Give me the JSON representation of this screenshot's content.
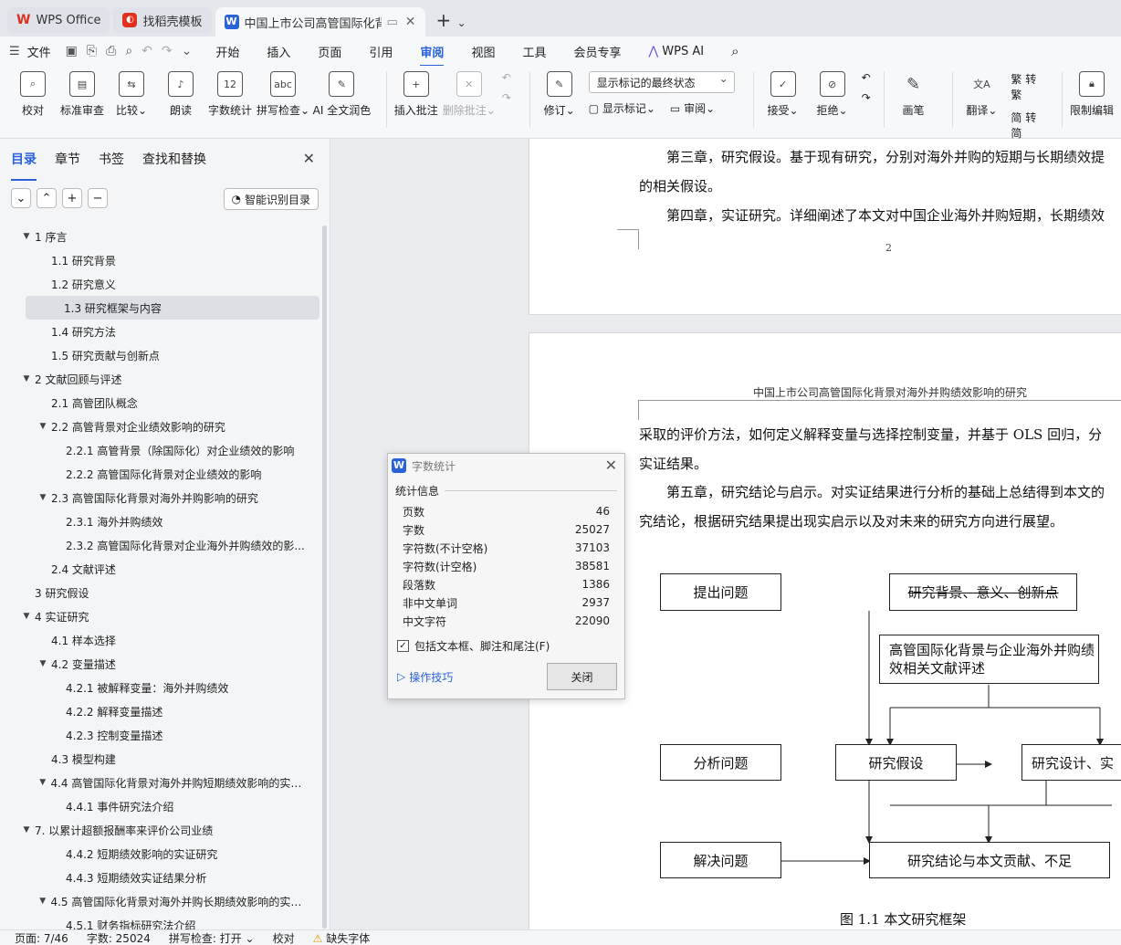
{
  "tabs": [
    {
      "label": "WPS Office"
    },
    {
      "label": "找稻壳模板"
    },
    {
      "label": "中国上市公司高管国际化背景..."
    }
  ],
  "menu": {
    "file": "文件",
    "items": [
      "开始",
      "插入",
      "页面",
      "引用",
      "审阅",
      "视图",
      "工具",
      "会员专享"
    ],
    "active": "审阅",
    "ai": "WPS AI"
  },
  "ribbon": {
    "group1": [
      "校对",
      "标准审查",
      "比较",
      "朗读",
      "字数统计",
      "拼写检查",
      "AI 全文润色"
    ],
    "comments": [
      "插入批注",
      "删除批注"
    ],
    "track": {
      "revise": "修订",
      "select": "显示标记的最终状态",
      "show": "显示标记",
      "review": "审阅"
    },
    "accept": "接受",
    "reject": "拒绝",
    "pen": "画笔",
    "translate": "翻译",
    "to_trad": "转繁",
    "to_simp": "转简",
    "restrict": "限制编辑"
  },
  "sidebar": {
    "tabs": [
      "目录",
      "章节",
      "书签",
      "查找和替换"
    ],
    "smart": "智能识别目录",
    "toc": [
      {
        "level": 0,
        "text": "1  序言",
        "arrow": "▼"
      },
      {
        "level": 1,
        "text": "1.1  研究背景"
      },
      {
        "level": 1,
        "text": "1.2  研究意义"
      },
      {
        "level": 1,
        "text": "1.3  研究框架与内容",
        "selected": true
      },
      {
        "level": 1,
        "text": "1.4  研究方法"
      },
      {
        "level": 1,
        "text": "1.5  研究贡献与创新点"
      },
      {
        "level": 0,
        "text": "2  文献回顾与评述",
        "arrow": "▼"
      },
      {
        "level": 1,
        "text": "2.1 高管团队概念"
      },
      {
        "level": 1,
        "text": "2.2  高管背景对企业绩效影响的研究",
        "arrow": "▼"
      },
      {
        "level": 2,
        "text": "2.2.1  高管背景（除国际化）对企业绩效的影响"
      },
      {
        "level": 2,
        "text": "2.2.2  高管国际化背景对企业绩效的影响"
      },
      {
        "level": 1,
        "text": "2.3  高管国际化背景对海外并购影响的研究",
        "arrow": "▼"
      },
      {
        "level": 2,
        "text": "2.3.1  海外并购绩效"
      },
      {
        "level": 2,
        "text": "2.3.2  高管国际化背景对企业海外并购绩效的影..."
      },
      {
        "level": 1,
        "text": "2.4  文献评述"
      },
      {
        "level": 0,
        "text": "3  研究假设"
      },
      {
        "level": 0,
        "text": "4  实证研究",
        "arrow": "▼"
      },
      {
        "level": 1,
        "text": "4.1 样本选择"
      },
      {
        "level": 1,
        "text": "4.2  变量描述",
        "arrow": "▼"
      },
      {
        "level": 2,
        "text": "4.2.1  被解释变量：海外并购绩效"
      },
      {
        "level": 2,
        "text": "4.2.2  解释变量描述"
      },
      {
        "level": 2,
        "text": "4.2.3  控制变量描述"
      },
      {
        "level": 1,
        "text": "4.3  模型构建"
      },
      {
        "level": 1,
        "text": "4.4  高管国际化背景对海外并购短期绩效影响的实证 ...",
        "arrow": "▼"
      },
      {
        "level": 2,
        "text": "4.4.1  事件研究法介绍"
      },
      {
        "level": 0,
        "text": "7.  以累计超额报酬率来评价公司业绩",
        "arrow": "▼"
      },
      {
        "level": 2,
        "text": "4.4.2  短期绩效影响的实证研究"
      },
      {
        "level": 2,
        "text": "4.4.3  短期绩效实证结果分析"
      },
      {
        "level": 1,
        "text": "4.5  高管国际化背景对海外并购长期绩效影响的实证 ...",
        "arrow": "▼"
      },
      {
        "level": 2,
        "text": "4.5.1  财务指标研究法介绍"
      }
    ]
  },
  "doc": {
    "p1a": "第三章，研究假设。基于现有研究，分别对海外并购的短期与长期绩效提",
    "p1b": "的相关假设。",
    "p2": "第四章，实证研究。详细阐述了本文对中国企业海外并购短期，长期绩效",
    "page_num": "2",
    "header": "中国上市公司高管国际化背景对海外并购绩效影响的研究",
    "p3a": "采取的评价方法，如何定义解释变量与选择控制变量，并基于 OLS 回归，分",
    "p3b": "实证结果。",
    "p4a": "第五章，研究结论与启示。对实证结果进行分析的基础上总结得到本文的",
    "p4b": "究结论，根据研究结果提出现实启示以及对未来的研究方向进行展望。",
    "diagram": {
      "q1": "提出问题",
      "b1": "研究背景、意义、创新点",
      "b2": "高管国际化背景与企业海外并购绩效相关文献评述",
      "q2": "分析问题",
      "b3": "研究假设",
      "b4": "研究设计、实",
      "q3": "解决问题",
      "b5": "研究结论与本文贡献、不足"
    },
    "caption": "图 1.1  本文研究框架"
  },
  "dialog": {
    "title": "字数统计",
    "section": "统计信息",
    "rows": [
      [
        "页数",
        "46"
      ],
      [
        "字数",
        "25027"
      ],
      [
        "字符数(不计空格)",
        "37103"
      ],
      [
        "字符数(计空格)",
        "38581"
      ],
      [
        "段落数",
        "1386"
      ],
      [
        "非中文单词",
        "2937"
      ],
      [
        "中文字符",
        "22090"
      ]
    ],
    "checkbox": "包括文本框、脚注和尾注(F)",
    "tips": "操作技巧",
    "close": "关闭"
  },
  "status": {
    "page": "页面: 7/46",
    "words": "字数: 25024",
    "spell": "拼写检查: 打开",
    "proof": "校对",
    "font": "缺失字体"
  }
}
